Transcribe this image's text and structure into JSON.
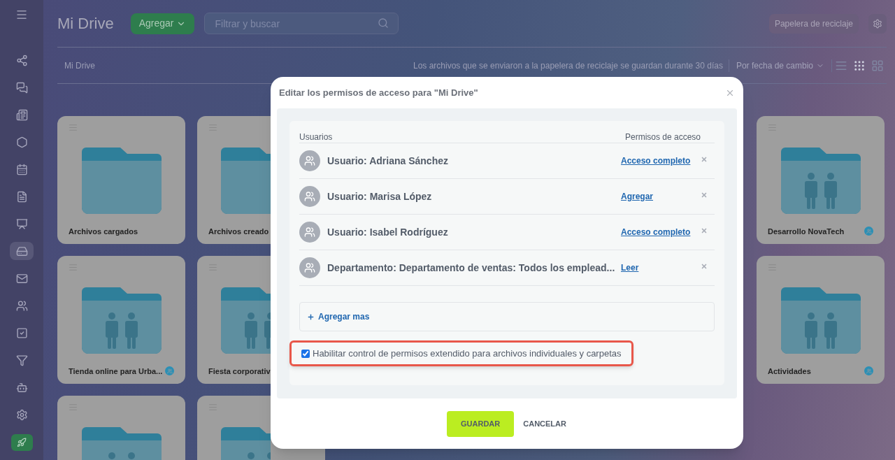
{
  "sidebar": {
    "items": [
      {
        "selected": false
      },
      {
        "selected": false
      },
      {
        "selected": false
      },
      {
        "selected": false
      },
      {
        "selected": false
      },
      {
        "selected": false
      },
      {
        "selected": false
      },
      {
        "selected": true
      },
      {
        "selected": false
      },
      {
        "selected": false
      },
      {
        "selected": false
      },
      {
        "selected": false
      },
      {
        "selected": false
      },
      {
        "selected": false
      }
    ]
  },
  "header": {
    "title": "Mi Drive",
    "add_button": "Agregar",
    "search": {
      "placeholder": "Filtrar y buscar"
    },
    "trash_button": "Papelera de reciclaje"
  },
  "toolbar": {
    "breadcrumb": "Mi Drive",
    "notice": "Los archivos que se enviaron a la papelera de reciclaje se guardan durante 30 días",
    "sort": "Por fecha de cambio",
    "views": [
      {
        "selected": false
      },
      {
        "selected": true
      },
      {
        "selected": false
      }
    ]
  },
  "folders": [
    [
      {
        "kind": "plain",
        "name": "Archivos cargados",
        "shared": false
      },
      {
        "kind": "plain",
        "name": "Archivos creado"
      },
      {
        "kind": "people",
        "name": "Desarrollo NovaTech",
        "shared": true
      }
    ],
    [
      {
        "kind": "people",
        "name": "Tienda online para Urba...",
        "shared": true
      },
      {
        "kind": "people",
        "name": "Fiesta corporativ"
      },
      {
        "kind": "people",
        "name": "Actividades",
        "shared": true
      }
    ],
    [
      {
        "kind": "people"
      },
      {
        "kind": "people"
      }
    ]
  ],
  "dialog": {
    "title": "Editar los permisos de acceso para \"Mi Drive\"",
    "columns": [
      "Usuarios",
      "Permisos de acceso"
    ],
    "entries": [
      {
        "name": "Usuario: Adriana Sánchez",
        "permission": "Acceso completo"
      },
      {
        "name": "Usuario: Marisa López",
        "permission": "Agregar"
      },
      {
        "name": "Usuario: Isabel Rodríguez",
        "permission": "Acceso completo"
      },
      {
        "name": "Departamento: Departamento de ventas: Todos los emplead...",
        "permission": "Leer"
      }
    ],
    "add_more": "Agregar mas",
    "option": {
      "label": "Habilitar control de permisos extendido para archivos individuales y carpetas",
      "checked": true,
      "highlighted": true
    },
    "buttons": [
      {
        "kind": "primary",
        "label": "GUARDAR"
      },
      {
        "kind": "link",
        "label": "CANCELAR"
      }
    ]
  }
}
